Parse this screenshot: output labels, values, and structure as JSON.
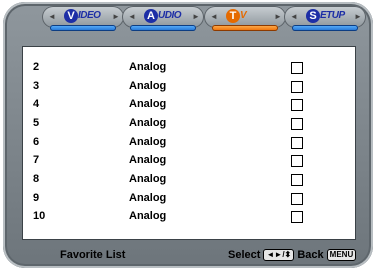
{
  "tabs": [
    {
      "letter": "V",
      "rest": "IDEO",
      "active": false
    },
    {
      "letter": "A",
      "rest": "UDIO",
      "active": false
    },
    {
      "letter": "T",
      "rest": "V",
      "active": true
    },
    {
      "letter": "S",
      "rest": "ETUP",
      "active": false
    }
  ],
  "channels": [
    {
      "num": "2",
      "type": "Analog",
      "checked": false
    },
    {
      "num": "3",
      "type": "Analog",
      "checked": false
    },
    {
      "num": "4",
      "type": "Analog",
      "checked": false
    },
    {
      "num": "5",
      "type": "Analog",
      "checked": false
    },
    {
      "num": "6",
      "type": "Analog",
      "checked": false
    },
    {
      "num": "7",
      "type": "Analog",
      "checked": false
    },
    {
      "num": "8",
      "type": "Analog",
      "checked": false
    },
    {
      "num": "9",
      "type": "Analog",
      "checked": false
    },
    {
      "num": "10",
      "type": "Analog",
      "checked": false
    }
  ],
  "footer": {
    "title": "Favorite List",
    "select_label": "Select",
    "nav_key": "◄►/⬍",
    "back_label": "Back",
    "menu_key": "MENU"
  },
  "colors": {
    "active": "#e56a00",
    "inactive": "#1d2ea6",
    "frame": "#7c8489"
  }
}
